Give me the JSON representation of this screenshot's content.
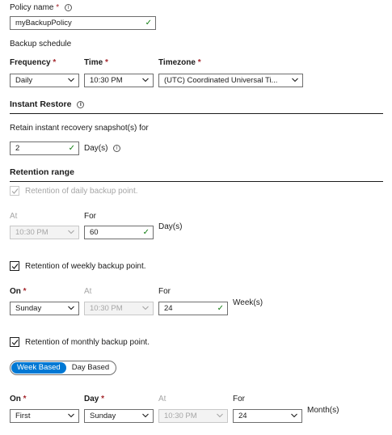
{
  "policy": {
    "label": "Policy name",
    "req": "*",
    "value": "myBackupPolicy"
  },
  "schedule": {
    "heading": "Backup schedule",
    "frequency": {
      "label": "Frequency",
      "req": "*",
      "value": "Daily"
    },
    "time": {
      "label": "Time",
      "req": "*",
      "value": "10:30 PM"
    },
    "timezone": {
      "label": "Timezone",
      "req": "*",
      "value": "(UTC) Coordinated Universal Ti..."
    }
  },
  "instant": {
    "heading": "Instant Restore",
    "retain_label": "Retain instant recovery snapshot(s) for",
    "value": "2",
    "unit": "Day(s)"
  },
  "retention": {
    "heading": "Retention range",
    "daily": {
      "label": "Retention of daily backup point.",
      "at_label": "At",
      "at_value": "10:30 PM",
      "for_label": "For",
      "for_value": "60",
      "unit": "Day(s)"
    },
    "weekly": {
      "label": "Retention of weekly backup point.",
      "on_label": "On",
      "on_req": "*",
      "on_value": "Sunday",
      "at_label": "At",
      "at_value": "10:30 PM",
      "for_label": "For",
      "for_value": "24",
      "unit": "Week(s)"
    },
    "monthly": {
      "label": "Retention of monthly backup point.",
      "toggle": {
        "week": "Week Based",
        "day": "Day Based"
      },
      "on_label": "On",
      "on_req": "*",
      "on_value": "First",
      "day_label": "Day",
      "day_req": "*",
      "day_value": "Sunday",
      "at_label": "At",
      "at_value": "10:30 PM",
      "for_label": "For",
      "for_value": "24",
      "unit": "Month(s)"
    }
  }
}
